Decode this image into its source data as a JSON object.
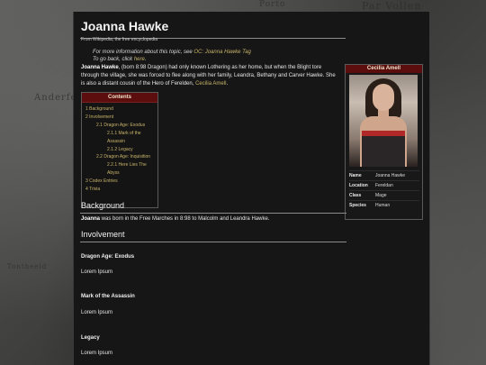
{
  "background": {
    "labels": [
      "Porto",
      "Par Vollen",
      "Anderfel",
      "Tontheeld"
    ]
  },
  "article": {
    "title": "Joanna Hawke",
    "from": "From Wikipedia, the free encyclopedia",
    "hatnote_prefix": "For more information about this topic, see ",
    "hatnote_link": "OC: Joanna Hawke Tag",
    "hatnote_back_prefix": "To go back, click ",
    "hatnote_back_link": "here",
    "hatnote_back_suffix": ".",
    "lead_name": "Joanna Hawke",
    "lead_text": ", (born 8:98 Dragon) had only known Lothering as her home, but when the Blight tore through the village, she was forced to flee along with her family, Leandra, Bethany and Carver Hawke. She is also a distant cousin of the Hero of Ferelden, ",
    "lead_link": "Cecilia Amell",
    "lead_end": "."
  },
  "toc": {
    "title": "Contents",
    "items": [
      {
        "text": "1 Background"
      },
      {
        "text": "2 Involvement"
      },
      {
        "text": "2.1 Dragon Age: Exodus"
      },
      {
        "text": "2.1.1 Mark of the"
      },
      {
        "text": "Assassin"
      },
      {
        "text": "2.1.2 Legacy"
      },
      {
        "text": "2.2 Dragon Age: Inquisition"
      },
      {
        "text": "2.2.1 Here Lies The"
      },
      {
        "text": "Abyss"
      },
      {
        "text": "3 Codex Entries"
      },
      {
        "text": "4 Trivia"
      }
    ]
  },
  "infobox": {
    "title": "Cecilia Amell",
    "rows": [
      {
        "key": "Name",
        "value": "Joanna Hawke"
      },
      {
        "key": "Location",
        "value": "Fereldan"
      },
      {
        "key": "Class",
        "value": "Mage"
      },
      {
        "key": "Species",
        "value": "Human"
      }
    ]
  },
  "sections": {
    "background_title": "Background",
    "background_name": "Joanna",
    "background_text": " was born in the Free Marches in 8:98 to Malcolm and Leandra Hawke.",
    "involvement_title": "Involvement",
    "sub1_title": "Dragon Age: Exodus",
    "sub1_text": "Lorem Ipsum",
    "sub2_title": "Mark of the Assassin",
    "sub2_text": "Lorem Ipsum",
    "sub3_title": "Legacy",
    "sub3_text": "Lorem Ipsum"
  },
  "colors": {
    "accent_header": "#5c0d0d",
    "link": "#c8b46a",
    "page_bg": "#161616"
  }
}
